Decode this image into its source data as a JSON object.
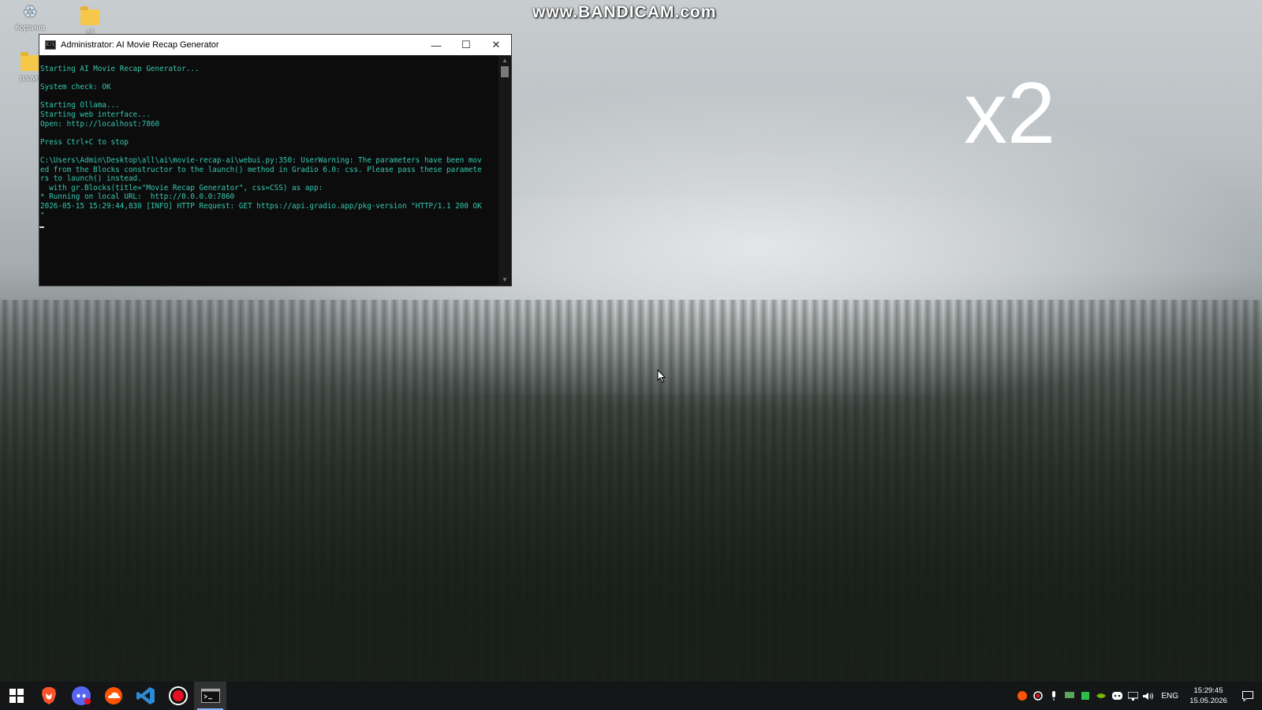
{
  "watermark": "www.BANDICAM.com",
  "speed_overlay": "x2",
  "desktop": {
    "icons": [
      {
        "label": "Корзина",
        "icon": "recycle-bin-icon"
      },
      {
        "label": "all",
        "icon": "folder-icon"
      },
      {
        "label": "разуе",
        "icon": "folder-icon"
      }
    ]
  },
  "window": {
    "title": "Administrator:  AI Movie Recap Generator",
    "controls": {
      "minimize": "—",
      "maximize": "☐",
      "close": "✕"
    },
    "console_lines": [
      "Starting AI Movie Recap Generator...",
      "",
      "System check: OK",
      "",
      "Starting Ollama...",
      "Starting web interface...",
      "Open: http://localhost:7860",
      "",
      "Press Ctrl+C to stop",
      "",
      "C:\\Users\\Admin\\Desktop\\all\\ai\\movie-recap-ai\\webui.py:350: UserWarning: The parameters have been mov",
      "ed from the Blocks constructor to the launch() method in Gradio 6.0: css. Please pass these paramete",
      "rs to launch() instead.",
      "  with gr.Blocks(title=\"Movie Recap Generator\", css=CSS) as app:",
      "* Running on local URL:  http://0.0.0.0:7860",
      "2026-05-15 15:29:44,830 [INFO] HTTP Request: GET https://api.gradio.app/pkg-version \"HTTP/1.1 200 OK",
      "\""
    ]
  },
  "taskbar": {
    "apps": [
      {
        "name": "windows-start",
        "icon": "windows-logo-icon"
      },
      {
        "name": "brave-browser",
        "icon": "brave-lion-icon",
        "color": "#fb542b"
      },
      {
        "name": "discord",
        "icon": "discord-icon",
        "color": "#5865f2"
      },
      {
        "name": "soundcloud-like",
        "icon": "cloud-app-icon",
        "color": "#ff5500"
      },
      {
        "name": "vscode",
        "icon": "vscode-icon",
        "color": "#2f8ad6"
      },
      {
        "name": "bandicam",
        "icon": "record-icon",
        "color": "#e81123"
      },
      {
        "name": "terminal",
        "icon": "terminal-icon",
        "active": true
      }
    ],
    "tray": {
      "language": "ENG",
      "time": "15:29:45",
      "date": "15.05.2026"
    }
  }
}
